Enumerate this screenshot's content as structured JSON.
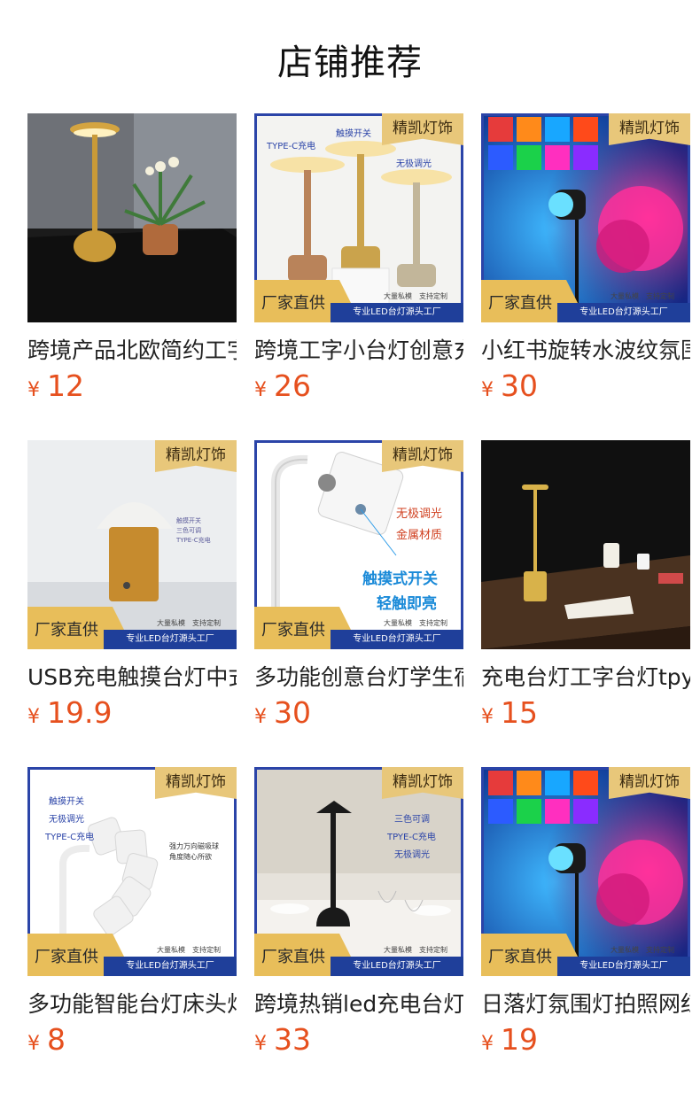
{
  "page": {
    "title": "店铺推荐"
  },
  "banner": {
    "brand": "精凯灯饰",
    "factory": "厂家直供",
    "strip": "专业LED台灯源头工厂",
    "small": "大量私模　支持定制"
  },
  "products": [
    {
      "name": "跨境产品北欧简约工字台灯",
      "currency": "¥",
      "price": "12"
    },
    {
      "name": "跨境工字小台灯创意充电",
      "currency": "¥",
      "price": "26",
      "tags": [
        "TYPE-C充电",
        "触摸开关",
        "无极调光"
      ]
    },
    {
      "name": "小红书旋转水波纹氛围灯",
      "currency": "¥",
      "price": "30"
    },
    {
      "name": "USB充电触摸台灯中式",
      "currency": "¥",
      "price": "19.9",
      "tags": [
        "触摸开关",
        "三色可调",
        "TYPE-C充电"
      ]
    },
    {
      "name": "多功能创意台灯学生宿舍",
      "currency": "¥",
      "price": "30",
      "tags": [
        "无极调光",
        "金属材质",
        "触摸式开关",
        "轻触即亮"
      ]
    },
    {
      "name": "充电台灯工字台灯tpye",
      "currency": "¥",
      "price": "15"
    },
    {
      "name": "多功能智能台灯床头灯",
      "currency": "¥",
      "price": "8",
      "tags": [
        "触摸开关",
        "无极调光",
        "TYPE-C充电",
        "强力万向磁吸球",
        "角度随心所欲"
      ]
    },
    {
      "name": "跨境热销led充电台灯",
      "currency": "¥",
      "price": "33",
      "tags": [
        "三色可调",
        "TPYE-C充电",
        "无极调光"
      ]
    },
    {
      "name": "日落灯氛围灯拍照网红",
      "currency": "¥",
      "price": "19"
    }
  ],
  "colors": {
    "price": "#e6501e",
    "brand_gold": "#e8be5a",
    "factory_blue": "#1f3f9a"
  }
}
